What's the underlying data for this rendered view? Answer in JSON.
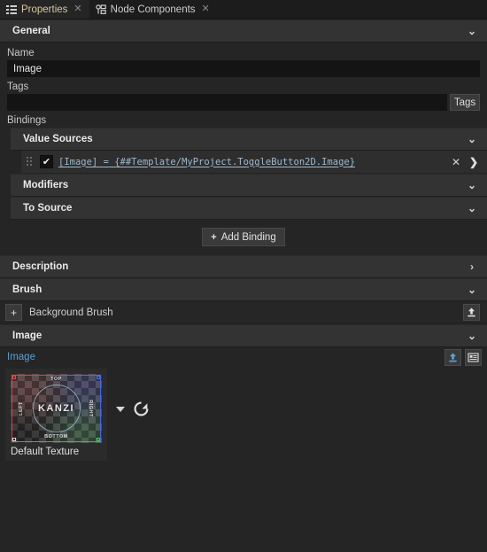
{
  "tabs": [
    {
      "label": "Properties",
      "icon": "properties-list-icon",
      "active": true,
      "close": "✕"
    },
    {
      "label": "Node Components",
      "icon": "node-components-icon",
      "active": false,
      "close": "✕"
    }
  ],
  "sections": {
    "general": {
      "title": "General",
      "chevron": "⌄"
    },
    "value_sources": {
      "title": "Value Sources",
      "chevron": "⌄"
    },
    "modifiers": {
      "title": "Modifiers",
      "chevron": "⌄"
    },
    "to_source": {
      "title": "To Source",
      "chevron": "⌄"
    },
    "description": {
      "title": "Description",
      "chevron": "›"
    },
    "brush": {
      "title": "Brush",
      "chevron": "⌄"
    },
    "image": {
      "title": "Image",
      "chevron": "⌄"
    }
  },
  "general": {
    "name_label": "Name",
    "name_value": "Image",
    "name_placeholder": "",
    "tags_label": "Tags",
    "tags_value": "",
    "tags_placeholder": "",
    "tags_button": "Tags"
  },
  "bindings": {
    "label": "Bindings",
    "rows": [
      {
        "checked": "✔",
        "expression": "[Image] = {##Template/MyProject.ToggleButton2D.Image}",
        "remove": "✕",
        "expand": "❯"
      }
    ],
    "add_button": {
      "plus": "+",
      "label": "Add Binding"
    }
  },
  "brush": {
    "background_brush": {
      "add": "+",
      "label": "Background Brush",
      "upload_icon": "upload-icon"
    }
  },
  "image_property": {
    "label": "Image",
    "upload_icon": "upload-icon",
    "properties_icon": "show-properties-icon",
    "texture": {
      "caption": "Default Texture",
      "face_labels": {
        "top": "TOP",
        "bottom": "BOTTOM",
        "left": "LEFT",
        "right": "RIGHT",
        "center": "KANZI"
      }
    },
    "dropdown_icon": "chevron-down-icon",
    "reset_icon": "reset-icon"
  },
  "colors": {
    "panel_bg": "#252525",
    "header_bg": "#333333",
    "active_tab_text": "#d8c89a",
    "link_blue": "#5a9fd4",
    "binding_text": "#9fb8cc",
    "accent_upload": "#57a8e0"
  }
}
